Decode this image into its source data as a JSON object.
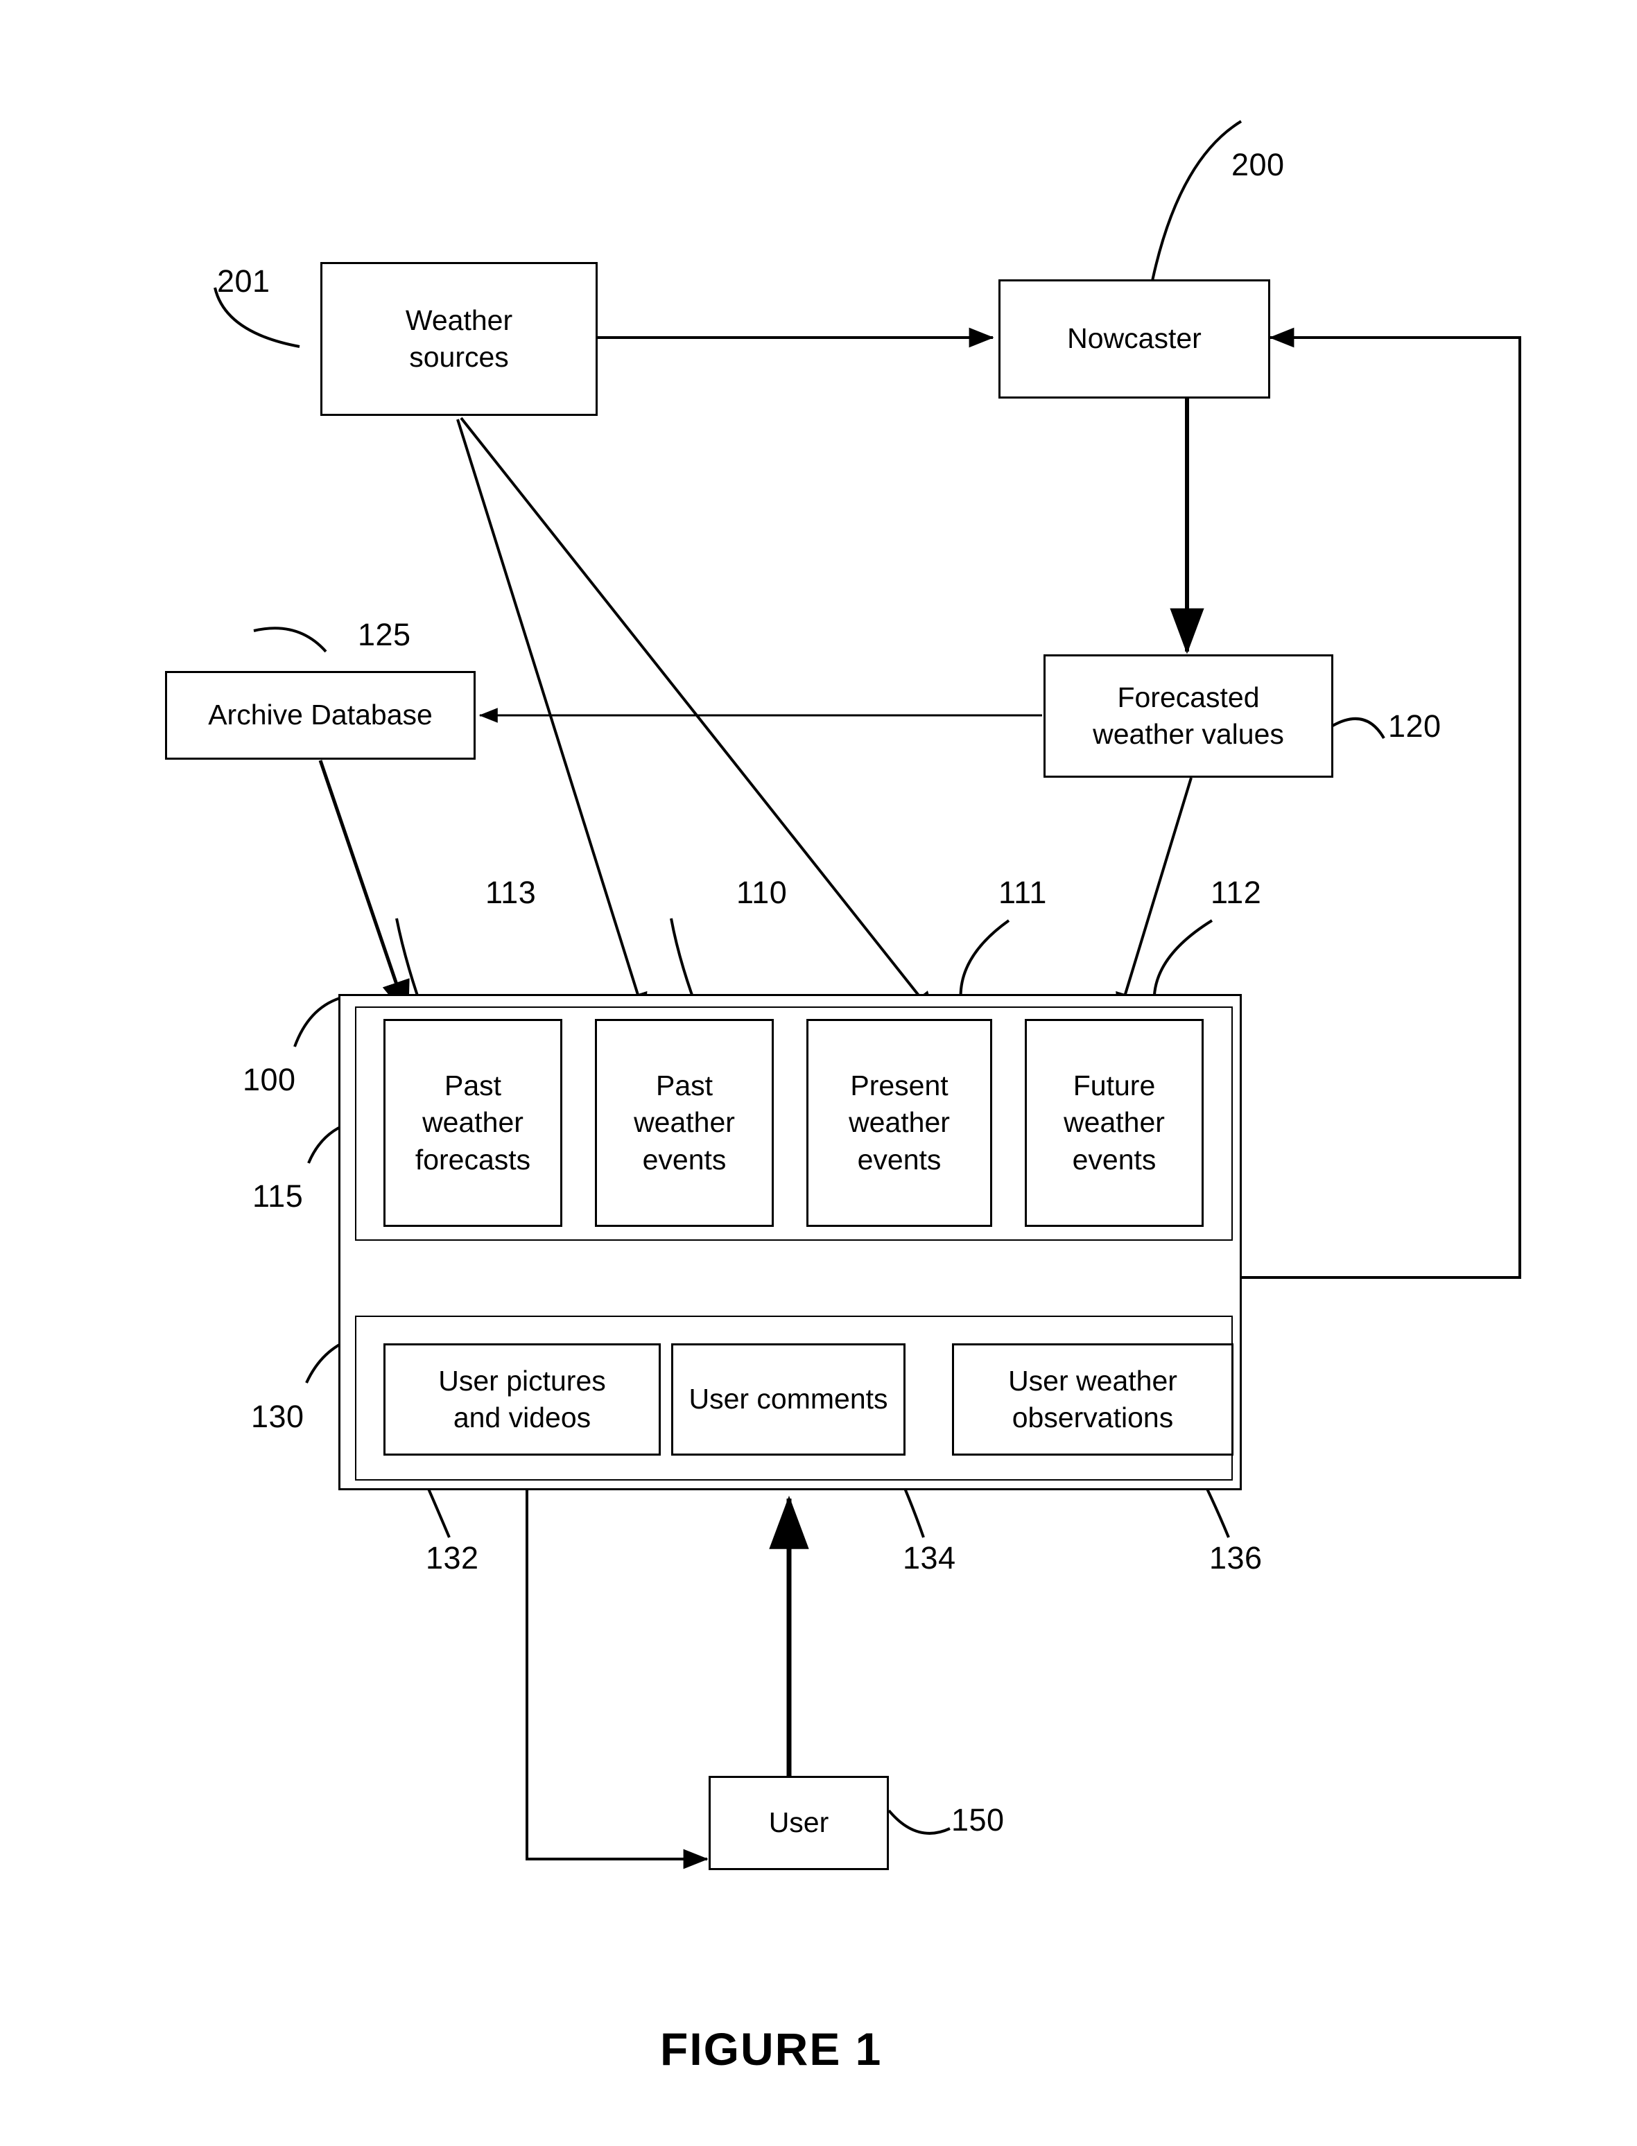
{
  "figure": {
    "caption": "FIGURE 1"
  },
  "nodes": {
    "weather_sources": {
      "label_line1": "Weather",
      "label_line2": "sources",
      "ref": "201"
    },
    "nowcaster": {
      "label": "Nowcaster",
      "ref": "200"
    },
    "archive_database": {
      "label": "Archive Database",
      "ref": "125"
    },
    "forecasted_weather_values": {
      "label_line1": "Forecasted",
      "label_line2": "weather values",
      "ref": "120"
    },
    "past_weather_forecasts": {
      "label_line1": "Past",
      "label_line2": "weather",
      "label_line3": "forecasts",
      "ref": "113"
    },
    "past_weather_events": {
      "label_line1": "Past",
      "label_line2": "weather",
      "label_line3": "events",
      "ref": "110"
    },
    "present_weather_events": {
      "label_line1": "Present",
      "label_line2": "weather",
      "label_line3": "events",
      "ref": "111"
    },
    "future_weather_events": {
      "label_line1": "Future",
      "label_line2": "weather",
      "label_line3": "events",
      "ref": "112"
    },
    "user_pictures_and_videos": {
      "label_line1": "User pictures",
      "label_line2": "and videos",
      "ref": "132"
    },
    "user_comments": {
      "label": "User comments",
      "ref": "134"
    },
    "user_weather_observations": {
      "label_line1": "User weather",
      "label_line2": "observations",
      "ref": "136"
    },
    "user": {
      "label": "User",
      "ref": "150"
    }
  },
  "containers": {
    "system": {
      "ref": "100"
    },
    "weather_event_group": {
      "ref": "115"
    },
    "user_content_group": {
      "ref": "130"
    }
  },
  "colors": {
    "stroke": "#000000",
    "background": "#ffffff"
  }
}
